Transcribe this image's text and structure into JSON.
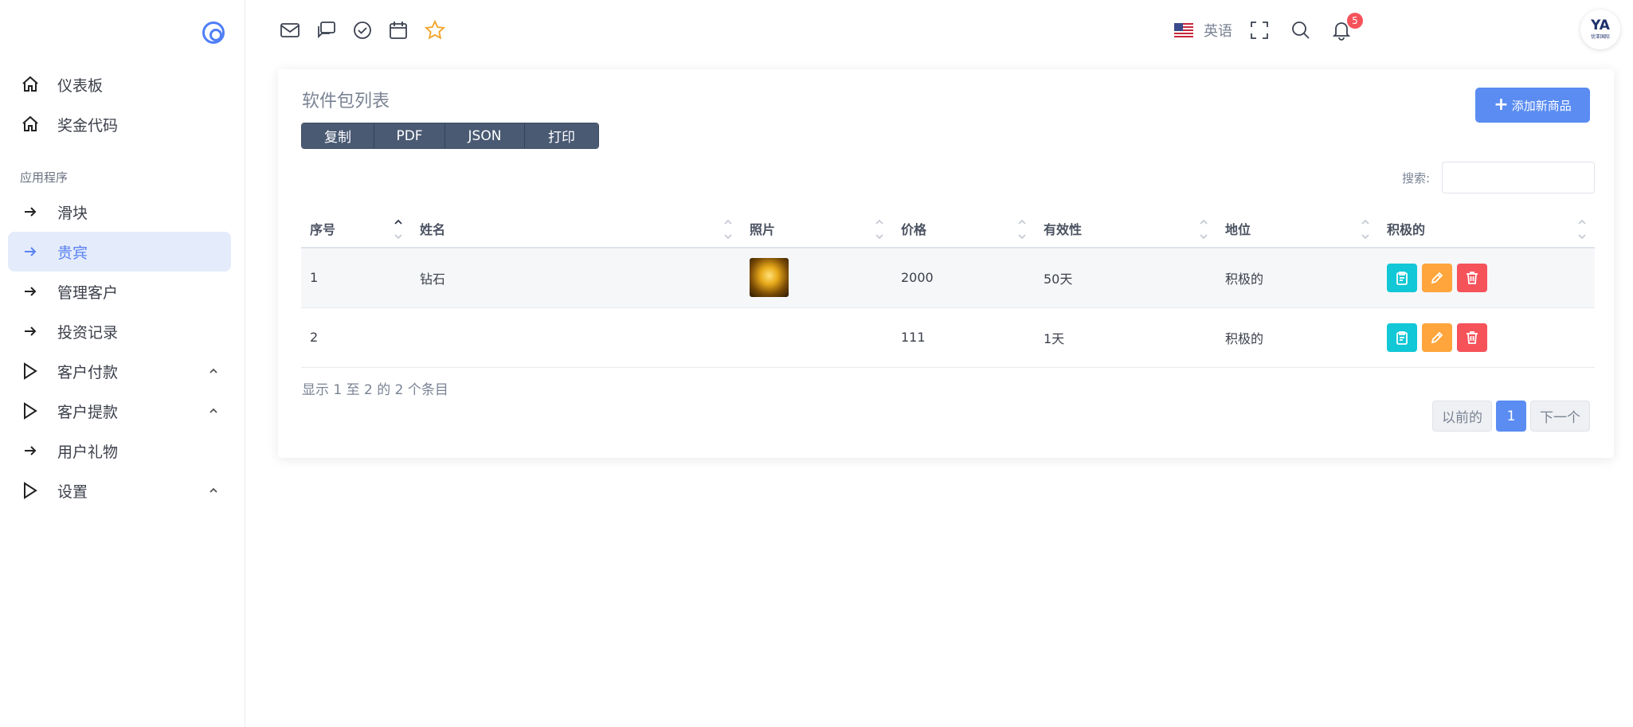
{
  "sidebar": {
    "items": [
      {
        "label": "仪表板",
        "icon": "home-icon"
      },
      {
        "label": "奖金代码",
        "icon": "home-icon"
      },
      {
        "label": "滑块",
        "icon": "arrow-right-icon"
      },
      {
        "label": "贵宾",
        "icon": "arrow-right-icon",
        "active": true
      },
      {
        "label": "管理客户",
        "icon": "arrow-right-icon"
      },
      {
        "label": "投资记录",
        "icon": "arrow-right-icon"
      },
      {
        "label": "客户付款",
        "icon": "play-icon"
      },
      {
        "label": "客户提款",
        "icon": "play-icon"
      },
      {
        "label": "用户礼物",
        "icon": "arrow-right-icon"
      },
      {
        "label": "设置",
        "icon": "play-icon"
      }
    ],
    "section_label": "应用程序"
  },
  "header": {
    "language": "英语",
    "notification_count": "5",
    "avatar_mark": "YA",
    "avatar_sub": "优亚国际",
    "icons": [
      "mail-icon",
      "chat-icon",
      "check-circle-icon",
      "calendar-icon",
      "star-icon",
      "fullscreen-icon",
      "search-icon",
      "bell-icon"
    ]
  },
  "card": {
    "title": "软件包列表",
    "export_buttons": [
      "复制",
      "PDF",
      "JSON",
      "打印"
    ],
    "add_button": "添加新商品",
    "search_label": "搜索:",
    "search_value": "",
    "columns": [
      "序号",
      "姓名",
      "照片",
      "价格",
      "有效性",
      "地位",
      "积极的"
    ],
    "rows": [
      {
        "id": "1",
        "name": "钻石",
        "has_photo": true,
        "price": "2000",
        "validity": "50天",
        "status": "积极的"
      },
      {
        "id": "2",
        "name": "",
        "has_photo": false,
        "price": "111",
        "validity": "1天",
        "status": "积极的"
      }
    ],
    "info": "显示 1 至 2 的 2 个条目",
    "pager": {
      "prev": "以前的",
      "current": "1",
      "next": "下一个"
    }
  },
  "colors": {
    "accent": "#5a8cf2",
    "view": "#12c7d6",
    "edit": "#ffa53b",
    "delete": "#f5525a",
    "export": "#4a5a73"
  }
}
